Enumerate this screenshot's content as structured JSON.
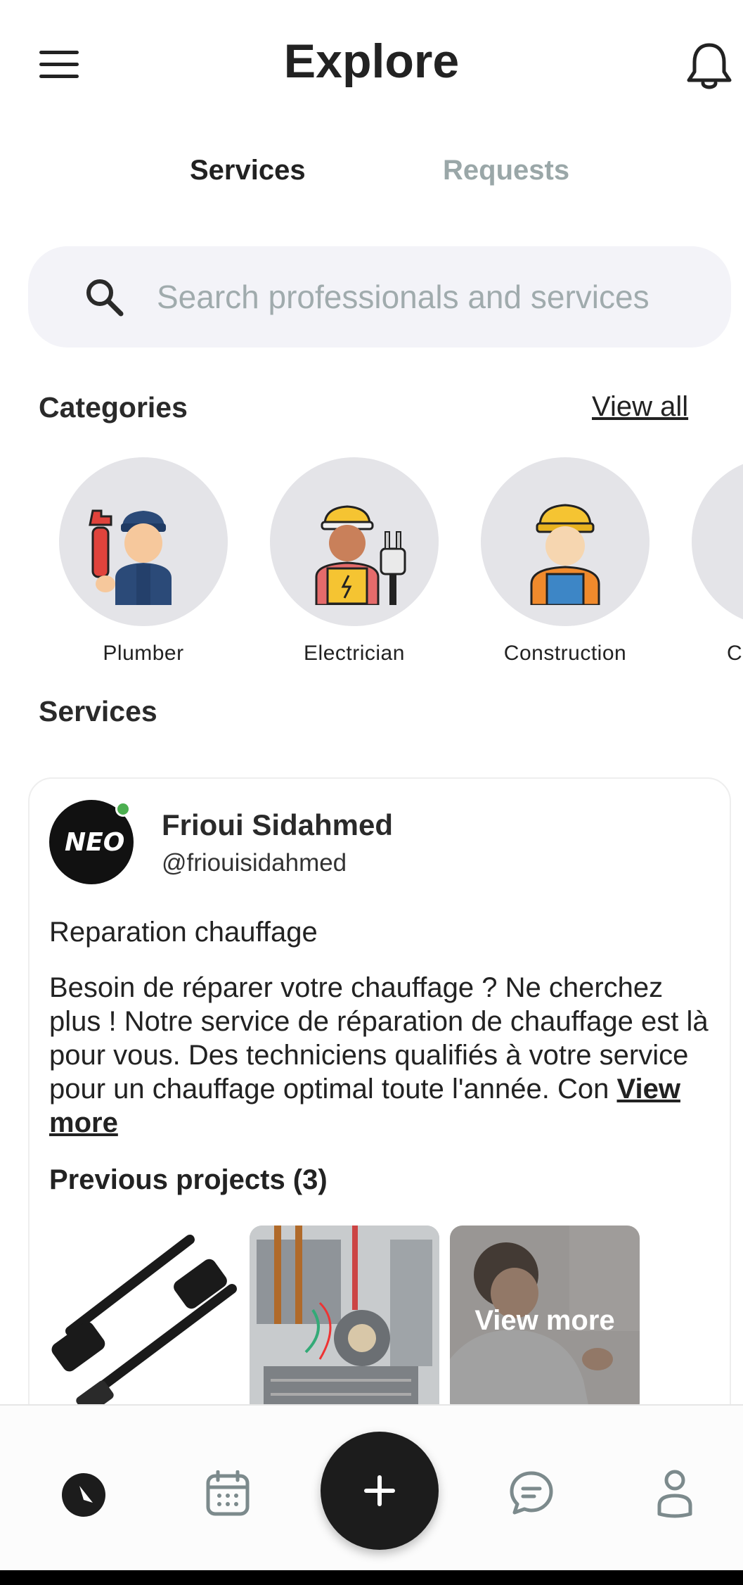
{
  "header": {
    "title": "Explore",
    "menu_icon": "hamburger-menu-icon",
    "bell_icon": "bell-icon"
  },
  "tabs": [
    {
      "label": "Services",
      "active": true
    },
    {
      "label": "Requests",
      "active": false
    }
  ],
  "search": {
    "placeholder": "Search professionals and services",
    "value": ""
  },
  "categories": {
    "title": "Categories",
    "view_all": "View all",
    "items": [
      {
        "label": "Plumber",
        "icon": "plumber-icon"
      },
      {
        "label": "Electrician",
        "icon": "electrician-icon"
      },
      {
        "label": "Construction",
        "icon": "construction-worker-icon"
      },
      {
        "label": "C",
        "icon": "category-icon"
      }
    ]
  },
  "services": {
    "title": "Services",
    "card": {
      "name": "Frioui Sidahmed",
      "handle": "@friouisidahmed",
      "avatar_text": "NEO",
      "online": true,
      "service_title": "Reparation chauffage",
      "description": "Besoin de réparer votre chauffage ? Ne cherchez plus ! Notre service de réparation de chauffage est là pour vous. Des techniciens qualifiés à votre service pour un chauffage optimal toute l'année. Con",
      "view_more": "View more",
      "previous_projects": "Previous projects (3)",
      "thumb_more_label": "View more"
    }
  },
  "bottom_nav": {
    "items": [
      "compass-icon",
      "calendar-icon",
      "add-icon",
      "chat-icon",
      "profile-icon"
    ]
  },
  "colors": {
    "accent": "#1c1c1c",
    "inactive_tab": "#9aa7a8",
    "online": "#4caf50",
    "search_bg": "#f3f3f8"
  }
}
